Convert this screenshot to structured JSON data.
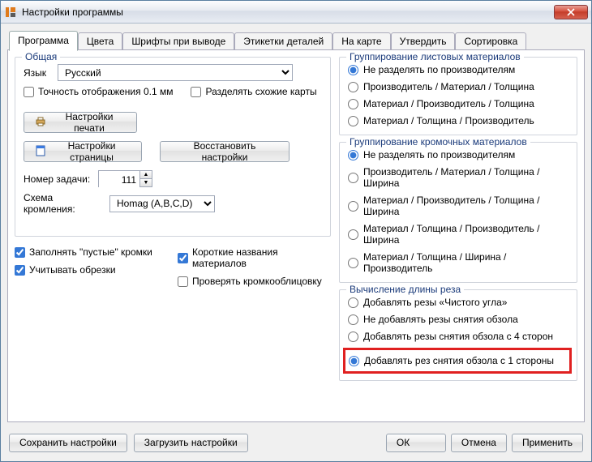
{
  "window": {
    "title": "Настройки программы",
    "close_tooltip": "Закрыть"
  },
  "tabs": {
    "program": "Программа",
    "colors": "Цвета",
    "fonts": "Шрифты при выводе",
    "labels": "Этикетки деталей",
    "on_map": "На карте",
    "approve": "Утвердить",
    "sorting": "Сортировка"
  },
  "general": {
    "legend": "Общая",
    "language_label": "Язык",
    "language_value": "Русский",
    "precision_label": "Точность отображения 0.1 мм",
    "split_maps_label": "Разделять схожие карты",
    "print_settings_btn": "Настройки печати",
    "page_settings_btn": "Настройки страницы",
    "restore_btn": "Восстановить настройки",
    "task_number_label": "Номер задачи:",
    "task_number_value": "111",
    "edge_scheme_label": "Схема кромления:",
    "edge_scheme_value": "Homag (A,B,C,D)"
  },
  "checks_left": {
    "fill_empty": "Заполнять \"пустые\" кромки",
    "short_names": "Короткие названия материалов",
    "use_offcuts": "Учитывать обрезки",
    "check_edgebanding": "Проверять кромкооблицовку"
  },
  "sheet_group": {
    "legend": "Группирование листовых материалов",
    "opt0": "Не разделять по производителям",
    "opt1": "Производитель / Материал / Толщина",
    "opt2": "Материал / Производитель / Толщина",
    "opt3": "Материал / Толщина / Производитель"
  },
  "edge_group": {
    "legend": "Группирование кромочных материалов",
    "opt0": "Не разделять по производителям",
    "opt1": "Производитель / Материал / Толщина / Ширина",
    "opt2": "Материал / Производитель / Толщина / Ширина",
    "opt3": "Материал / Толщина / Производитель / Ширина",
    "opt4": "Материал / Толщина / Ширина / Производитель"
  },
  "cut_length": {
    "legend": "Вычисление длины реза",
    "opt0": "Добавлять резы «Чистого угла»",
    "opt1": "Не добавлять резы снятия обзола",
    "opt2": "Добавлять резы снятия обзола с 4 сторон",
    "opt3": "Добавлять рез снятия обзола с 1 стороны"
  },
  "footer": {
    "save": "Сохранить настройки",
    "load": "Загрузить настройки",
    "ok": "ОК",
    "cancel": "Отмена",
    "apply": "Применить"
  }
}
